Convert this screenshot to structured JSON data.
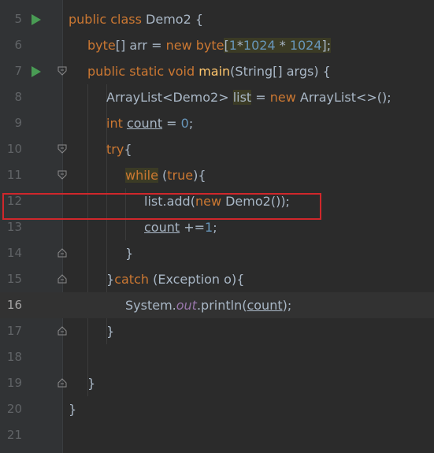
{
  "editor": {
    "line_numbers": [
      "5",
      "6",
      "7",
      "8",
      "9",
      "10",
      "11",
      "12",
      "13",
      "14",
      "15",
      "16",
      "17",
      "18",
      "19",
      "20",
      "21"
    ],
    "current_line": "16",
    "code": {
      "l5": {
        "kw1": "public class ",
        "cls": "Demo2 {"
      },
      "l6": {
        "kw1": "byte",
        "t1": "[] arr = ",
        "kw2": "new ",
        "kw3": "byte",
        "t2": "[",
        "n1": "1",
        "t3": "*",
        "n2": "1024",
        "t4": " * ",
        "n3": "1024",
        "t5": "];"
      },
      "l7": {
        "kw1": "public static void ",
        "fn": "main",
        "t1": "(String[] args) {"
      },
      "l8": {
        "t1": "ArrayList<Demo2> ",
        "var": "list",
        "t2": " = ",
        "kw1": "new ",
        "t3": "ArrayList<>();"
      },
      "l9": {
        "kw1": "int ",
        "var": "count",
        "t1": " = ",
        "n1": "0",
        "t2": ";"
      },
      "l10": {
        "kw1": "try",
        "t1": "{"
      },
      "l11": {
        "kw1": "while",
        "t1": " (",
        "kw2": "true",
        "t2": "){"
      },
      "l12": {
        "t1": "list.add(",
        "kw1": "new ",
        "t2": "Demo2());"
      },
      "l13": {
        "var": "count",
        "t1": " +=",
        "n1": "1",
        "t2": ";"
      },
      "l14": {
        "t1": "}"
      },
      "l15": {
        "t1": "}",
        "kw1": "catch",
        "t2": " (Exception o){"
      },
      "l16": {
        "t1": "System.",
        "st": "out",
        "t2": ".println(",
        "var": "count",
        "t3": ");"
      },
      "l17": {
        "t1": "}"
      },
      "l19": {
        "t1": "}"
      },
      "l20": {
        "t1": "}"
      }
    }
  }
}
